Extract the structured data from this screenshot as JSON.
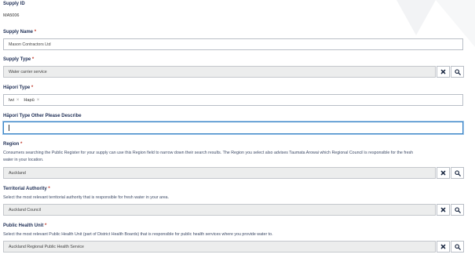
{
  "supply_id": {
    "label": "Supply ID",
    "value": "MA5006"
  },
  "supply_name": {
    "label": "Supply Name",
    "required": "*",
    "value": "Mason Contractors Ltd"
  },
  "supply_type": {
    "label": "Supply Type",
    "required": "*",
    "value": "Water carrier service"
  },
  "hapori_type": {
    "label": "Hāpori Type",
    "required": "*",
    "tags": [
      "Iwi",
      "Hapū"
    ]
  },
  "hapori_other": {
    "label": "Hāpori Type Other Please Describe",
    "value": ""
  },
  "region": {
    "label": "Region",
    "required": "*",
    "hint_line1": "Consumers searching the Public Register for your supply can use this Region field to narrow down their search results. The Region you select also advises Taumata Arowai which Regional Council is responsible for the fresh",
    "hint_line2": "water in your location.",
    "value": "Auckland"
  },
  "territorial_authority": {
    "label": "Territorial Authority",
    "required": "*",
    "hint": "Select the most relevant territorial authority that is responsible for fresh water in your area.",
    "value": "Auckland Council"
  },
  "public_health_unit": {
    "label": "Public Health Unit",
    "required": "*",
    "hint": "Select the most relevant Public Health Unit (part of District Health Boards) that is responsible for public health services where you provide water to.",
    "value": "Auckland Regional Public Health Service"
  },
  "icons": {
    "clear": "close-icon",
    "search": "search-icon",
    "tag_remove": "×"
  },
  "colors": {
    "label": "#1f2f56",
    "required": "#c0392b",
    "readonly_bg": "#eceded",
    "focus": "#3d86c6"
  }
}
